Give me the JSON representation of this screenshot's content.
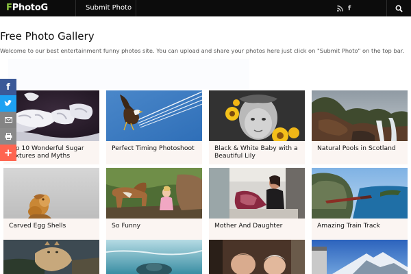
{
  "header": {
    "logo_f": "F",
    "logo_rest": "PhotoG",
    "nav_submit": "Submit Photo"
  },
  "page": {
    "title": "Free Photo Gallery",
    "intro": "Welcome to our best entertainment funny photos site. You can upload and share your photos here just click on \"Submit Photo\" on the top bar."
  },
  "share": [
    "facebook-icon",
    "twitter-icon",
    "email-icon",
    "print-icon",
    "more-share-icon"
  ],
  "colors": {
    "topbar": "#0c0c0c",
    "logo_accent": "#8bc53f",
    "facebook": "#3b5998",
    "twitter": "#1da1f2",
    "email": "#848484",
    "print": "#8a8a8a",
    "more": "#ff6550",
    "card_bg": "#fbf5f2"
  },
  "gallery": [
    {
      "caption": "Top 10 Wonderful Sugar Textures and Myths"
    },
    {
      "caption": "Perfect Timing Photoshoot"
    },
    {
      "caption": "Black & White Baby with a Beautiful Lily"
    },
    {
      "caption": "Natural Pools in Scotland"
    },
    {
      "caption": "Carved Egg Shells"
    },
    {
      "caption": "So Funny"
    },
    {
      "caption": "Mother And Daughter"
    },
    {
      "caption": "Amazing Train Track"
    }
  ]
}
